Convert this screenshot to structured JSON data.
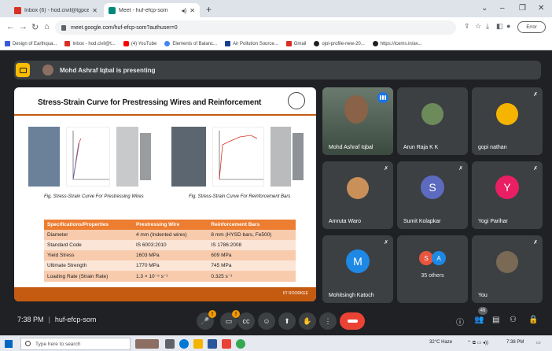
{
  "browser": {
    "tabs": [
      {
        "title": "Inbox (6) - hod.civil@tgpcet.com",
        "active": false
      },
      {
        "title": "Meet - huf-efcp-som",
        "active": true
      }
    ],
    "new_tab": "+",
    "url": "meet.google.com/huf-efcp-som?authuser=0",
    "error_label": "Error",
    "bookmarks": [
      {
        "label": "Design of Earthqua...",
        "color": "#3b5bdb"
      },
      {
        "label": "Inbox - hod.civil@t...",
        "color": "#d93025"
      },
      {
        "label": "(4) YouTube",
        "color": "#ff0000"
      },
      {
        "label": "Elements of Balanc...",
        "color": "#4285f4"
      },
      {
        "label": "Air Pollution Source...",
        "color": "#1a3d8f"
      },
      {
        "label": "Gmail",
        "color": "#d93025"
      },
      {
        "label": "ojol-profile-new-20...",
        "color": "#202124"
      },
      {
        "label": "https://icems.in/av...",
        "color": "#202124"
      }
    ]
  },
  "meet": {
    "presenting_text": "Mohd Ashraf Iqbal is presenting",
    "time": "7:38 PM",
    "meeting_code": "huf-efcp-som",
    "participant_count": "46",
    "slide": {
      "title": "Stress-Strain Curve for Prestressing Wires and Reinforcement",
      "caption_left": "Fig. Stress-Strain Curve For Prestressing Wires",
      "caption_right": "Fig. Stress-Strain Curve For Reinforcement Bars",
      "footer": "IIT ROORKEE",
      "table": {
        "headers": [
          "Specifications/Properties",
          "Prestressing Wire",
          "Reinforcement Bars"
        ],
        "rows": [
          [
            "Diameter",
            "4 mm (Indented wires)",
            "8 mm (HYSD bars, Fe500)"
          ],
          [
            "Standard Code",
            "IS 6003:2010",
            "IS 1786:2008"
          ],
          [
            "Yield Stress",
            "1603 MPa",
            "609 MPa"
          ],
          [
            "Ultimate Strength",
            "1770 MPa",
            "745 MPa"
          ],
          [
            "Loading Rate (Strain Rate)",
            "1.3 × 10⁻⁵ s⁻¹",
            "0.325 s⁻¹"
          ]
        ]
      }
    },
    "participants": [
      {
        "name": "Mohd Ashraf Iqbal",
        "type": "video"
      },
      {
        "name": "Arun Raja K K",
        "type": "photo",
        "color": "#6d8a5a"
      },
      {
        "name": "gopi nathan",
        "type": "photo",
        "color": "#f4b400"
      },
      {
        "name": "Amruta Waro",
        "type": "photo",
        "color": "#c9905a"
      },
      {
        "name": "Sumit Kolapkar",
        "type": "letter",
        "letter": "S",
        "color": "#5c6bc0"
      },
      {
        "name": "Yogi Parihar",
        "type": "letter",
        "letter": "Y",
        "color": "#e91e63"
      },
      {
        "name": "Mohitsingh Katoch",
        "type": "letter",
        "letter": "M",
        "color": "#1e88e5"
      },
      {
        "name": "35 others",
        "type": "others",
        "letters": [
          "S",
          "A"
        ],
        "colors": [
          "#e8553e",
          "#1e88e5"
        ]
      },
      {
        "name": "You",
        "type": "photo",
        "color": "#7a6a55"
      }
    ]
  },
  "taskbar": {
    "search_placeholder": "Type here to search",
    "weather": "32°C Haze",
    "clock": "7:38 PM"
  }
}
